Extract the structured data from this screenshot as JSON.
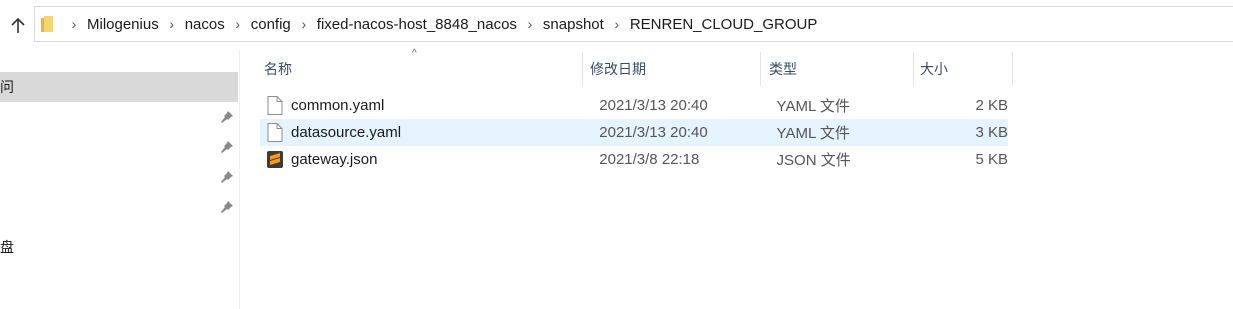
{
  "breadcrumb": [
    "Milogenius",
    "nacos",
    "config",
    "fixed-nacos-host_8848_nacos",
    "snapshot",
    "RENREN_CLOUD_GROUP"
  ],
  "nav": {
    "quick_access_label": "问",
    "drive_label": "盘"
  },
  "columns": {
    "name": "名称",
    "date": "修改日期",
    "type": "类型",
    "size": "大小"
  },
  "files": [
    {
      "name": "common.yaml",
      "date": "2021/3/13 20:40",
      "type": "YAML 文件",
      "size": "2 KB",
      "icon": "document-icon",
      "selected": false
    },
    {
      "name": "datasource.yaml",
      "date": "2021/3/13 20:40",
      "type": "YAML 文件",
      "size": "3 KB",
      "icon": "document-icon",
      "selected": true
    },
    {
      "name": "gateway.json",
      "date": "2021/3/8 22:18",
      "type": "JSON 文件",
      "size": "5 KB",
      "icon": "sublime-text-icon",
      "selected": false
    }
  ],
  "colors": {
    "selection": "#e5f3ff",
    "quick_access_bg": "#d9d9d9",
    "header_text": "#3c4a66"
  }
}
